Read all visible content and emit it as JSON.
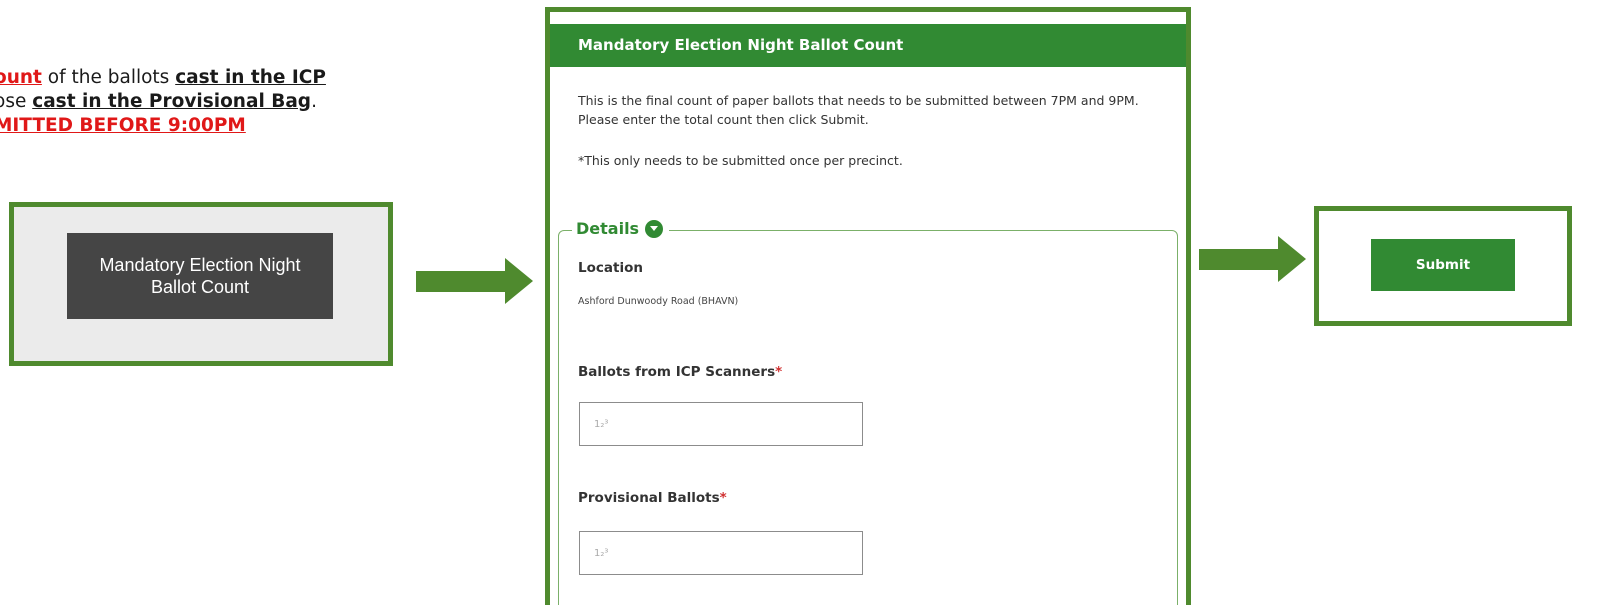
{
  "instructions": {
    "line1": [
      {
        "text": "ount",
        "style": "red-u"
      },
      {
        "text": " of the ballots ",
        "style": "plain"
      },
      {
        "text": "cast in the ICP",
        "style": "blk-u"
      }
    ],
    "line2": [
      {
        "text": "ose ",
        "style": "plain"
      },
      {
        "text": "cast in the Provisional Bag",
        "style": "blk-u"
      },
      {
        "text": ".",
        "style": "plain"
      }
    ],
    "line3": [
      {
        "text": "MITTED BEFORE 9:00PM",
        "style": "red-u"
      }
    ]
  },
  "left_button": {
    "label": "Mandatory Election Night\nBallot Count"
  },
  "form": {
    "title": "Mandatory Election Night Ballot Count",
    "description": "This is the final count of paper ballots that needs to be submitted between 7PM and 9PM. Please enter the total count then click Submit.",
    "note": "*This only needs to be submitted once per precinct.",
    "section_title": "Details",
    "location_label": "Location",
    "location_value": "Ashford Dunwoody Road (BHAVN)",
    "icp_label": "Ballots from ICP Scanners",
    "icp_placeholder": "1₂³",
    "provisional_label": "Provisional Ballots",
    "provisional_placeholder": "1₂³",
    "required_marker": "*"
  },
  "submit_button": {
    "label": "Submit"
  },
  "colors": {
    "frame_green": "#4f8a2e",
    "header_green": "#318a33",
    "required_red": "#d03030",
    "dark_button": "#454545"
  }
}
